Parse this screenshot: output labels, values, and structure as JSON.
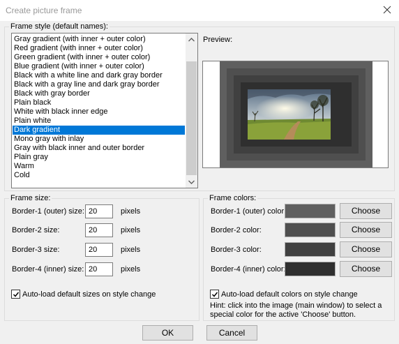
{
  "window": {
    "title": "Create picture frame"
  },
  "frame_style": {
    "legend": "Frame style (default names):",
    "items": [
      "Gray gradient (with inner + outer color)",
      "Red gradient (with inner + outer color)",
      "Green gradient (with inner + outer color)",
      "Blue gradient (with inner + outer color)",
      "Black with a white line and dark gray border",
      "Black with a gray line and dark gray border",
      "Black with gray border",
      "Plain black",
      "White with black inner edge",
      "Plain white",
      "Dark gradient",
      "Mono gray with inlay",
      "Gray with black inner and outer border",
      "Plain gray",
      "Warm",
      "Cold"
    ],
    "selected": "Dark gradient"
  },
  "preview": {
    "label": "Preview:"
  },
  "frame_size": {
    "legend": "Frame size:",
    "rows": [
      {
        "label": "Border-1 (outer) size:",
        "value": "20",
        "unit": "pixels"
      },
      {
        "label": "Border-2 size:",
        "value": "20",
        "unit": "pixels"
      },
      {
        "label": "Border-3 size:",
        "value": "20",
        "unit": "pixels"
      },
      {
        "label": "Border-4 (inner) size:",
        "value": "20",
        "unit": "pixels"
      }
    ],
    "autoload_label": "Auto-load default sizes on style change",
    "autoload_checked": true
  },
  "frame_colors": {
    "legend": "Frame colors:",
    "rows": [
      {
        "label": "Border-1 (outer) color:",
        "color": "#5f5f5f",
        "button": "Choose"
      },
      {
        "label": "Border-2 color:",
        "color": "#4f4f4f",
        "button": "Choose"
      },
      {
        "label": "Border-3 color:",
        "color": "#404040",
        "button": "Choose"
      },
      {
        "label": "Border-4 (inner) color:",
        "color": "#2f2f2f",
        "button": "Choose"
      }
    ],
    "autoload_label": "Auto-load default colors on style change",
    "autoload_checked": true,
    "hint": "Hint: click into the image (main window) to select a special color for the active 'Choose' button."
  },
  "footer": {
    "ok_label": "OK",
    "cancel_label": "Cancel"
  },
  "colors": {
    "selection": "#0078d7",
    "dialog_bg": "#f0f0f0"
  }
}
